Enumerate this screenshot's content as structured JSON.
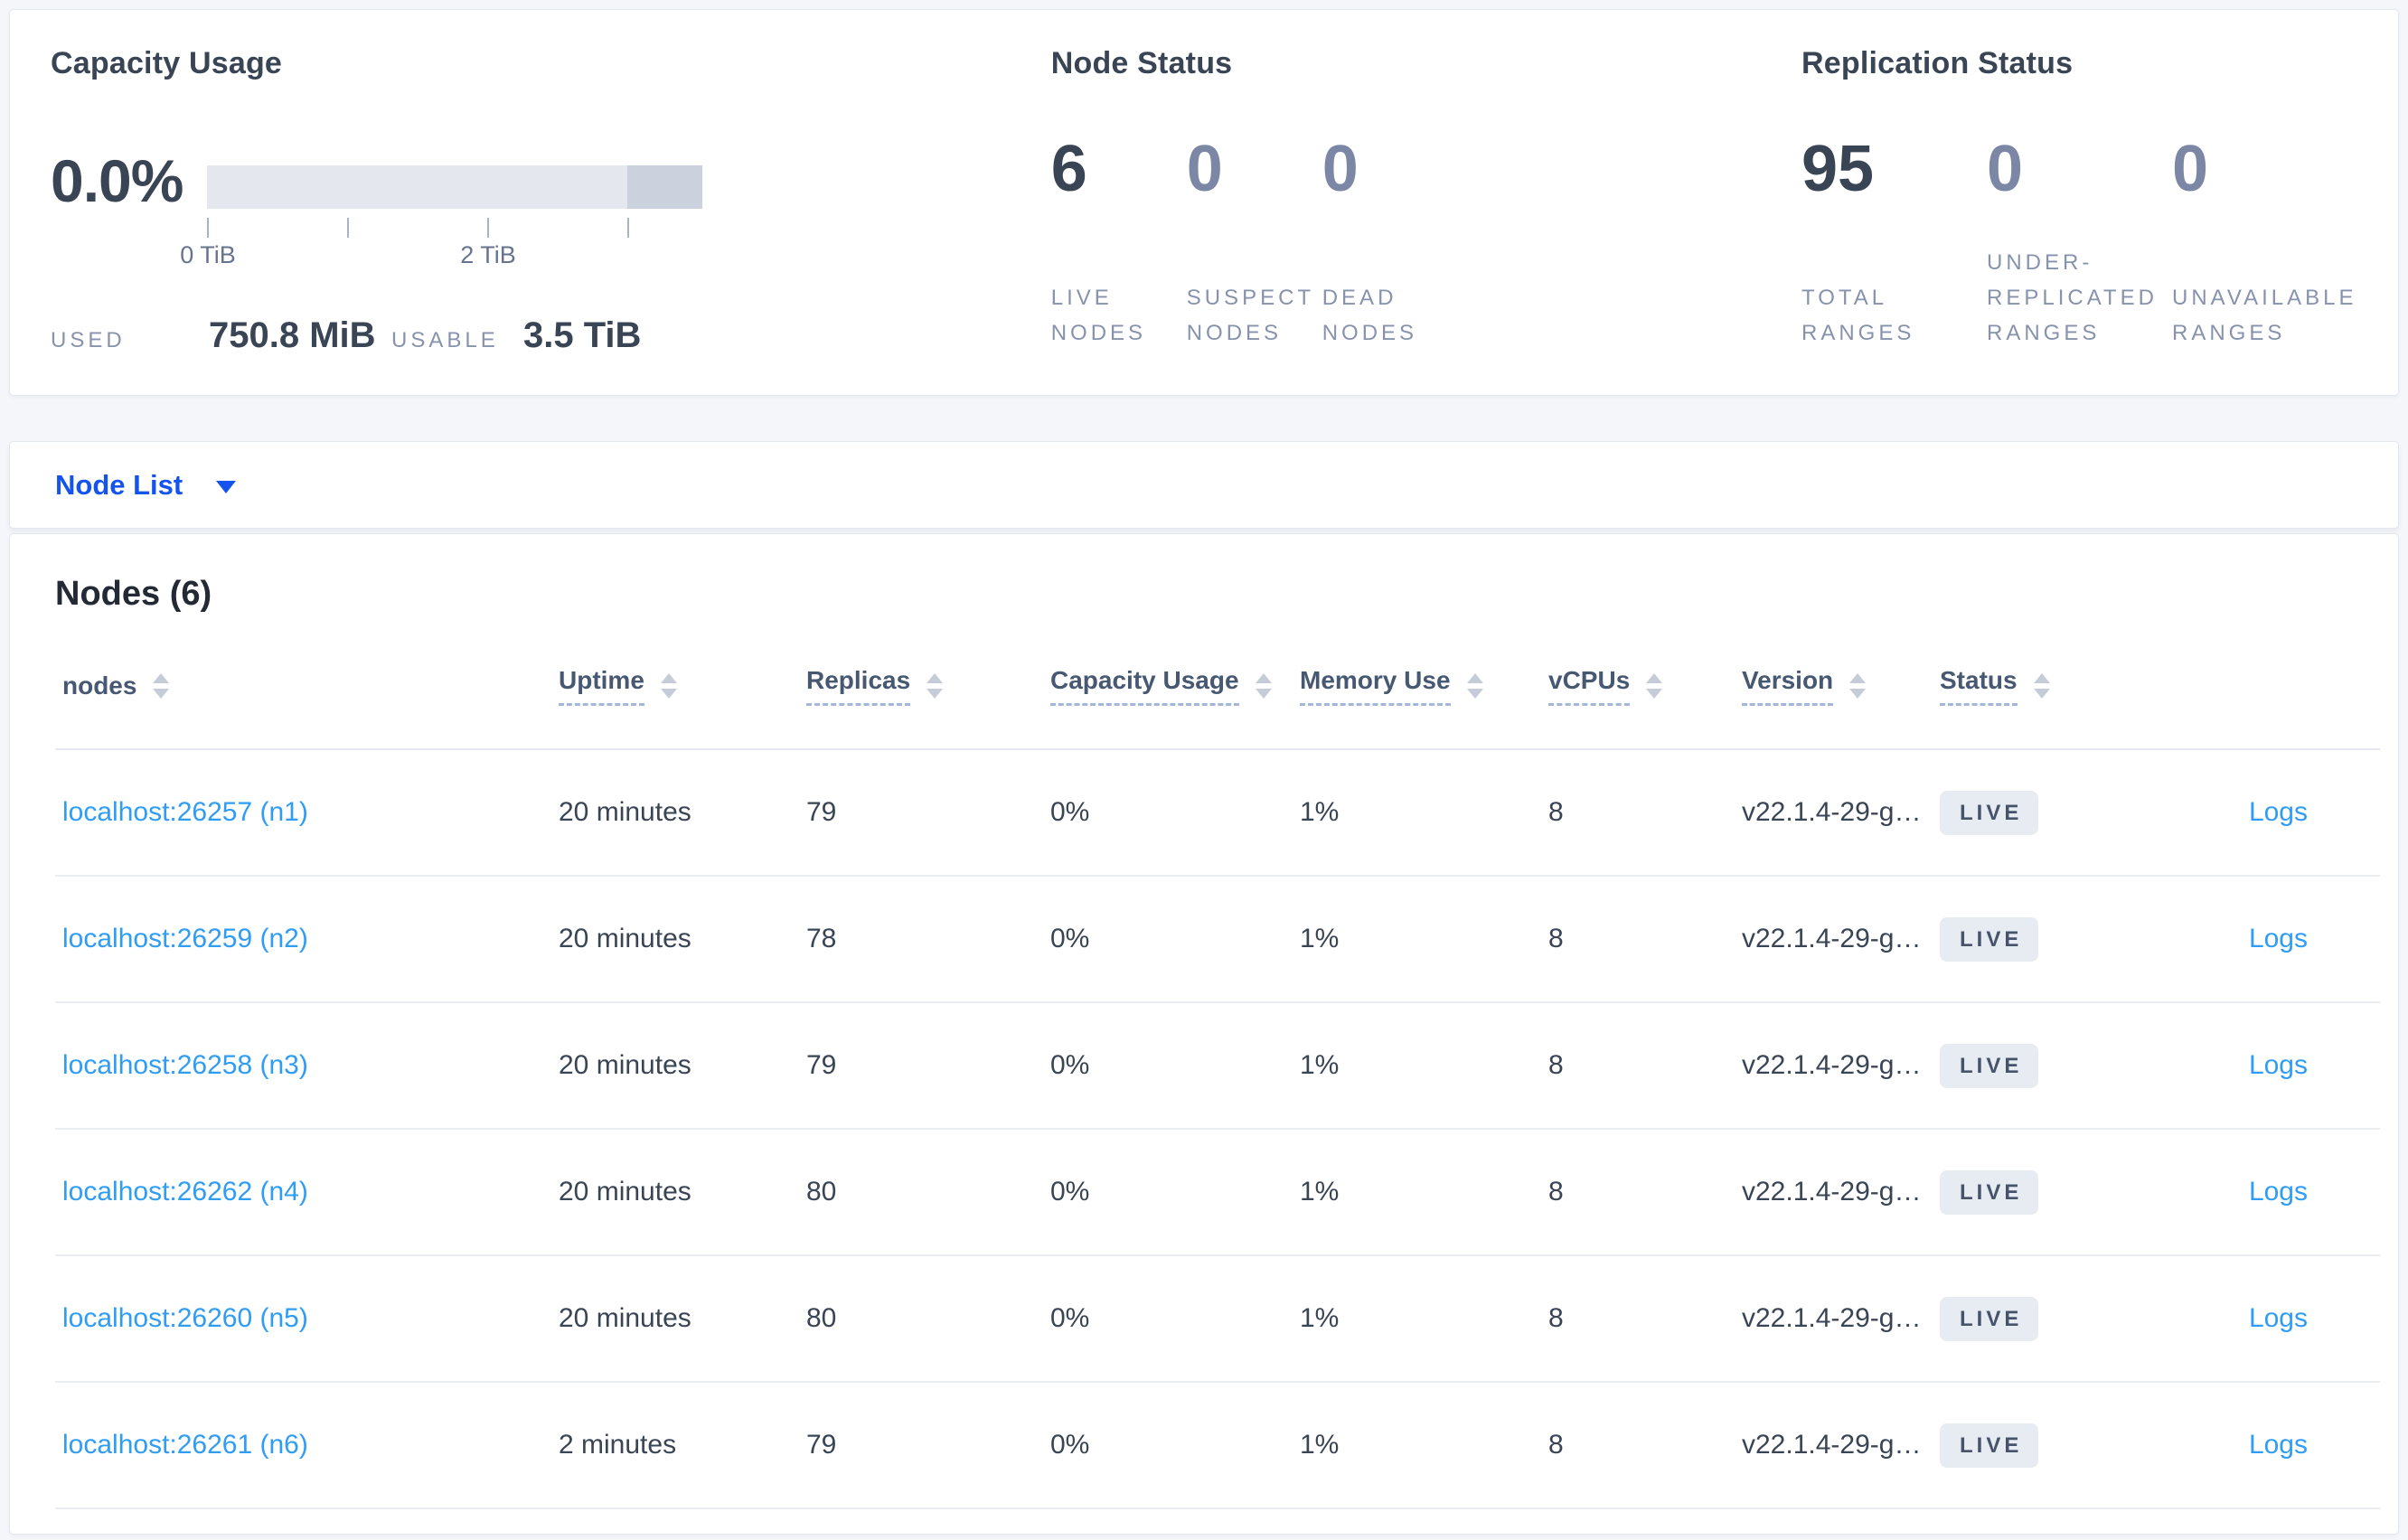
{
  "theme": {
    "page_background": "#f4f6fa",
    "card_background": "#ffffff",
    "dark_text": "#394455",
    "muted_stat": "#7b87a5",
    "label_slate": "#8792ad",
    "primary_link_blue": "#1553ef",
    "node_link_blue": "#2f9cf5",
    "live_badge_bg": "#e7ecf3",
    "meter_light": "#e4e7ed",
    "meter_dark": "#cbd1dd"
  },
  "capacity": {
    "title": "Capacity Usage",
    "percent": "0.0%",
    "meter": {
      "used_fraction": 0,
      "tick_labels": [
        "0 TiB",
        "2 TiB"
      ],
      "axis_ticks_tib": [
        0,
        1,
        2,
        3
      ],
      "max_tib": 3.5
    },
    "used_label": "USED",
    "used_value": "750.8 MiB",
    "usable_label": "USABLE",
    "usable_value": "3.5 TiB"
  },
  "node_status": {
    "title": "Node Status",
    "stats": [
      {
        "value": "6",
        "label": "LIVE NODES"
      },
      {
        "value": "0",
        "label": "SUSPECT NODES"
      },
      {
        "value": "0",
        "label": "DEAD NODES"
      }
    ]
  },
  "replication_status": {
    "title": "Replication Status",
    "stats": [
      {
        "value": "95",
        "label": "TOTAL RANGES"
      },
      {
        "value": "0",
        "label": "UNDER-REPLICATED RANGES"
      },
      {
        "value": "0",
        "label": "UNAVAILABLE RANGES"
      }
    ]
  },
  "node_list": {
    "label": "Node List"
  },
  "nodes_table": {
    "title": "Nodes (6)",
    "columns": [
      {
        "label": "nodes"
      },
      {
        "label": "Uptime"
      },
      {
        "label": "Replicas"
      },
      {
        "label": "Capacity Usage"
      },
      {
        "label": "Memory Use"
      },
      {
        "label": "vCPUs"
      },
      {
        "label": "Version"
      },
      {
        "label": "Status"
      }
    ],
    "rows": [
      {
        "name": "localhost:26257 (n1)",
        "uptime": "20 minutes",
        "replicas": "79",
        "capacity_usage": "0%",
        "memory_use": "1%",
        "vcpus": "8",
        "version": "v22.1.4-29-g…",
        "status": "LIVE",
        "logs": "Logs"
      },
      {
        "name": "localhost:26259 (n2)",
        "uptime": "20 minutes",
        "replicas": "78",
        "capacity_usage": "0%",
        "memory_use": "1%",
        "vcpus": "8",
        "version": "v22.1.4-29-g…",
        "status": "LIVE",
        "logs": "Logs"
      },
      {
        "name": "localhost:26258 (n3)",
        "uptime": "20 minutes",
        "replicas": "79",
        "capacity_usage": "0%",
        "memory_use": "1%",
        "vcpus": "8",
        "version": "v22.1.4-29-g…",
        "status": "LIVE",
        "logs": "Logs"
      },
      {
        "name": "localhost:26262 (n4)",
        "uptime": "20 minutes",
        "replicas": "80",
        "capacity_usage": "0%",
        "memory_use": "1%",
        "vcpus": "8",
        "version": "v22.1.4-29-g…",
        "status": "LIVE",
        "logs": "Logs"
      },
      {
        "name": "localhost:26260 (n5)",
        "uptime": "20 minutes",
        "replicas": "80",
        "capacity_usage": "0%",
        "memory_use": "1%",
        "vcpus": "8",
        "version": "v22.1.4-29-g…",
        "status": "LIVE",
        "logs": "Logs"
      },
      {
        "name": "localhost:26261 (n6)",
        "uptime": "2 minutes",
        "replicas": "79",
        "capacity_usage": "0%",
        "memory_use": "1%",
        "vcpus": "8",
        "version": "v22.1.4-29-g…",
        "status": "LIVE",
        "logs": "Logs"
      }
    ]
  }
}
